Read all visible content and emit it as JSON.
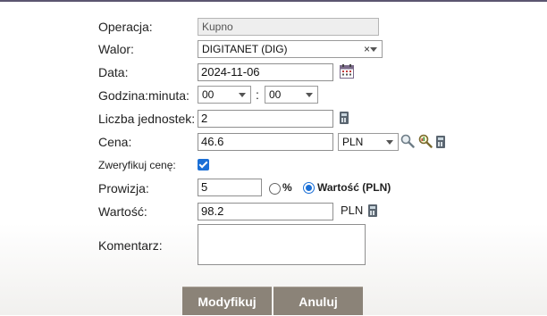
{
  "labels": {
    "operacja": "Operacja:",
    "walor": "Walor:",
    "data": "Data:",
    "godzina": "Godzina:minuta:",
    "liczba": "Liczba jednostek:",
    "cena": "Cena:",
    "zweryfikuj": "Zweryfikuj cenę:",
    "prowizja": "Prowizja:",
    "wartosc": "Wartość:",
    "komentarz": "Komentarz:"
  },
  "values": {
    "operacja": "Kupno",
    "walor": "DIGITANET (DIG)",
    "data": "2024-11-06",
    "hour": "00",
    "minute": "00",
    "time_sep": ":",
    "liczba": "2",
    "cena": "46.6",
    "currency": "PLN",
    "prowizja": "5",
    "wartosc": "98.2",
    "wartosc_currency": "PLN",
    "komentarz": ""
  },
  "options": {
    "prowizja_percent": "%",
    "prowizja_value": "Wartość (PLN)",
    "clear_symbol": "×"
  },
  "buttons": {
    "modify": "Modyfikuj",
    "cancel": "Anuluj"
  },
  "state": {
    "verify_checked": true,
    "prowizja_mode": "value"
  },
  "icons": [
    "calendar-icon",
    "calculator-icon",
    "search-icon",
    "search-chart-icon",
    "clear-icon",
    "chevron-down-icon"
  ],
  "colors": {
    "accent": "#1a6fd6",
    "button_bg": "#8b8378",
    "top_border": "#5b5570"
  }
}
